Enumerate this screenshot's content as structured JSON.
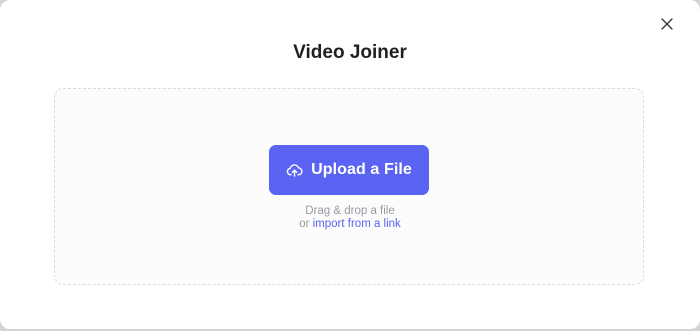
{
  "dialog": {
    "title": "Video Joiner",
    "close_icon": "close-icon"
  },
  "upload": {
    "button_label": "Upload a File",
    "button_icon": "cloud-upload-icon",
    "drag_text": "Drag & drop a file",
    "or_text": "or",
    "import_link": "import from a link"
  },
  "colors": {
    "accent": "#5a63f2",
    "background_overlay": "#d4d4d6",
    "hint_text": "#9a9aa3"
  }
}
